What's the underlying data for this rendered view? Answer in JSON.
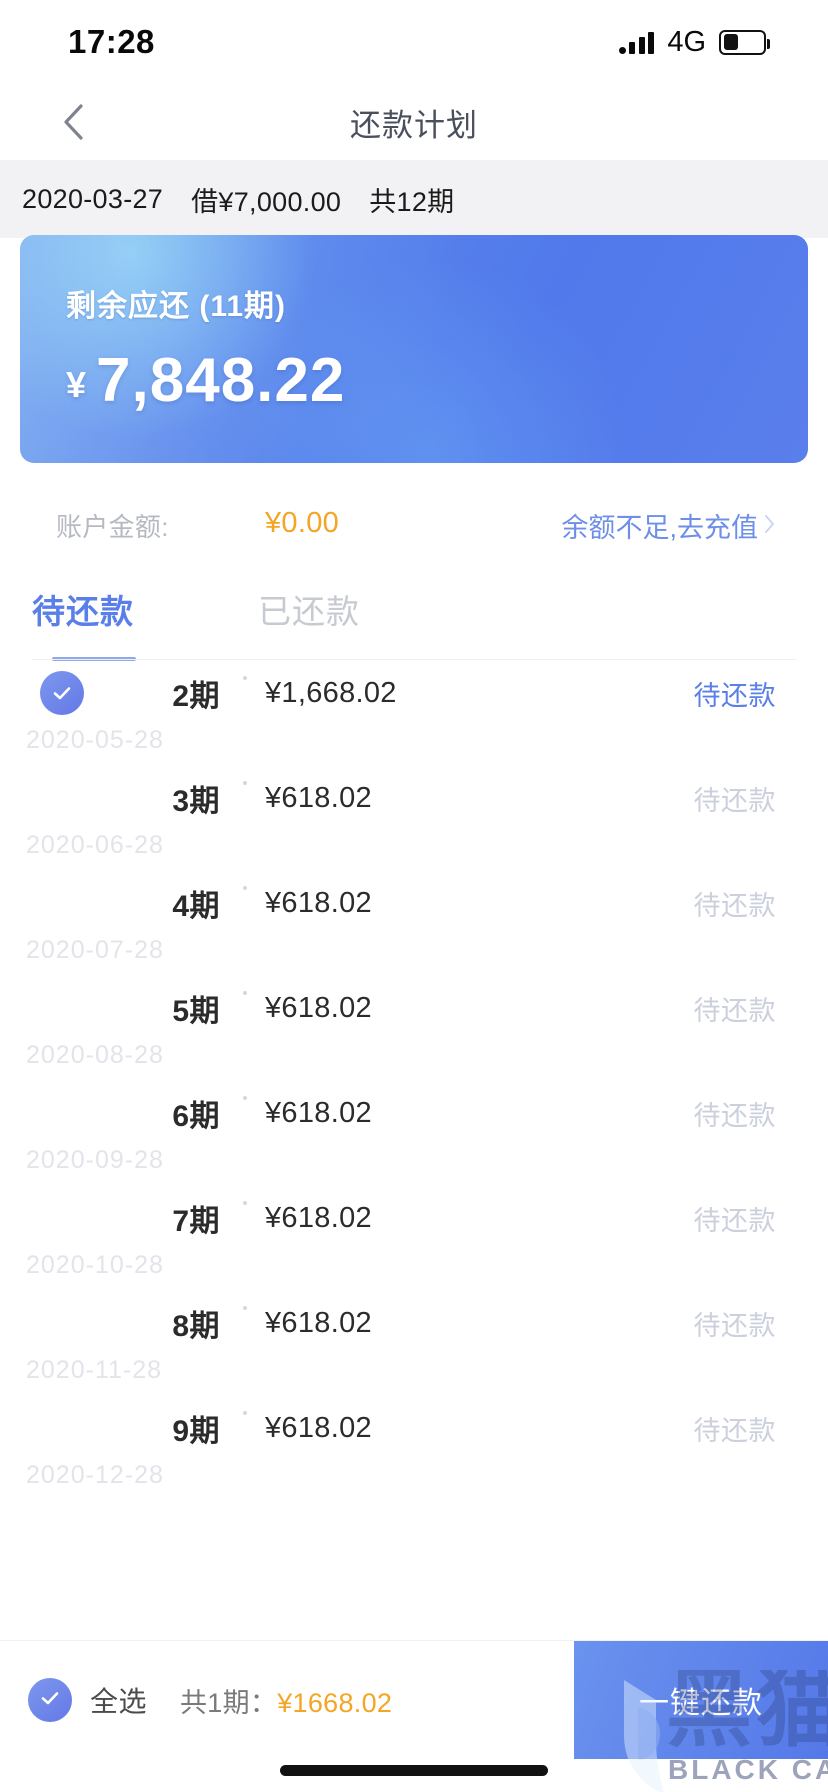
{
  "status_bar": {
    "time": "17:28",
    "network": "4G",
    "signal_icon": "signal-bars-icon",
    "battery_icon": "battery-low-icon"
  },
  "nav": {
    "back_icon": "chevron-left-icon",
    "title": "还款计划"
  },
  "summary": {
    "date": "2020-03-27",
    "principal": "借¥7,000.00",
    "terms": "共12期"
  },
  "card": {
    "label": "剩余应还 (11期)",
    "currency": "¥",
    "amount": "7,848.22",
    "gradient_from": "#6aa4ee",
    "gradient_to": "#5179eb"
  },
  "balance": {
    "label": "账户金额:",
    "amount": "¥0.00",
    "amount_color": "#f5a524",
    "action": "余额不足,去充值",
    "action_color": "#6d8fe8",
    "chevron_icon": "chevron-right-icon"
  },
  "tabs": [
    {
      "label": "待还款",
      "active": true
    },
    {
      "label": "已还款",
      "active": false
    }
  ],
  "accent_color": "#5b7fe8",
  "installments": [
    {
      "term": "2期",
      "amount": "¥1,668.02",
      "state": "待还款",
      "date": "2020-05-28",
      "checked": true,
      "highlight": true
    },
    {
      "term": "3期",
      "amount": "¥618.02",
      "state": "待还款",
      "date": "2020-06-28",
      "checked": false,
      "highlight": false
    },
    {
      "term": "4期",
      "amount": "¥618.02",
      "state": "待还款",
      "date": "2020-07-28",
      "checked": false,
      "highlight": false
    },
    {
      "term": "5期",
      "amount": "¥618.02",
      "state": "待还款",
      "date": "2020-08-28",
      "checked": false,
      "highlight": false
    },
    {
      "term": "6期",
      "amount": "¥618.02",
      "state": "待还款",
      "date": "2020-09-28",
      "checked": false,
      "highlight": false
    },
    {
      "term": "7期",
      "amount": "¥618.02",
      "state": "待还款",
      "date": "2020-10-28",
      "checked": false,
      "highlight": false
    },
    {
      "term": "8期",
      "amount": "¥618.02",
      "state": "待还款",
      "date": "2020-11-28",
      "checked": false,
      "highlight": false
    },
    {
      "term": "9期",
      "amount": "¥618.02",
      "state": "待还款",
      "date": "2020-12-28",
      "checked": false,
      "highlight": false
    }
  ],
  "bottom_bar": {
    "select_all_icon": "check-circle-icon",
    "select_all_label": "全选",
    "summary_prefix": "共1期：",
    "summary_amount": "¥1668.02",
    "summary_amount_color": "#f5a524",
    "pay_button": "一键还款"
  },
  "watermark": {
    "cn": "黑猫",
    "en": "BLACK CAT",
    "cat_icon": "cat-head-icon"
  }
}
